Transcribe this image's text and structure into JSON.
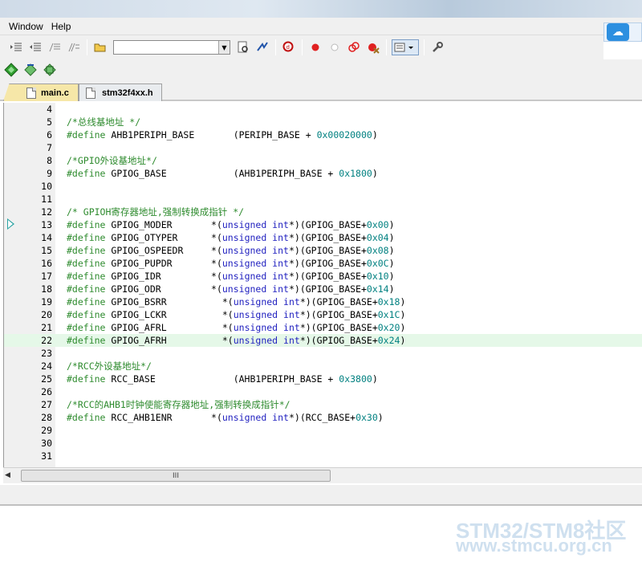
{
  "menu": {
    "items": [
      "Window",
      "Help"
    ]
  },
  "toolbar": {
    "combo_value": "",
    "icons": [
      "indent-icon",
      "outdent-icon",
      "comment-icon",
      "uncomment-icon",
      "open-folder-icon",
      "find-in-files-icon",
      "goto-icon",
      "debug-session-icon",
      "breakpoint-icon",
      "disabled-breakpoint-icon",
      "kill-breakpoints-icon",
      "kill-all-icon",
      "window-layout-icon",
      "configure-icon"
    ]
  },
  "tabs": [
    {
      "label": "main.c",
      "active": false
    },
    {
      "label": "stm32f4xx.h",
      "active": true
    }
  ],
  "code": {
    "highlighted_line": "22",
    "lines": [
      {
        "n": "4",
        "parts": []
      },
      {
        "n": "5",
        "parts": [
          {
            "t": "/*总线基地址 */",
            "c": "cmt"
          }
        ]
      },
      {
        "n": "6",
        "parts": [
          {
            "t": "#define",
            "c": "pp"
          },
          {
            "t": " AHB1PERIPH_BASE       (PERIPH_BASE + ",
            "c": ""
          },
          {
            "t": "0x00020000",
            "c": "num"
          },
          {
            "t": ")",
            "c": ""
          }
        ]
      },
      {
        "n": "7",
        "parts": []
      },
      {
        "n": "8",
        "parts": [
          {
            "t": "/*GPIO外设基地址*/",
            "c": "cmt"
          }
        ]
      },
      {
        "n": "9",
        "parts": [
          {
            "t": "#define",
            "c": "pp"
          },
          {
            "t": " GPIOG_BASE            (AHB1PERIPH_BASE + ",
            "c": ""
          },
          {
            "t": "0x1800",
            "c": "num"
          },
          {
            "t": ")",
            "c": ""
          }
        ]
      },
      {
        "n": "10",
        "parts": []
      },
      {
        "n": "11",
        "parts": []
      },
      {
        "n": "12",
        "parts": [
          {
            "t": "/* GPIOH寄存器地址,强制转换成指针 */",
            "c": "cmt"
          }
        ]
      },
      {
        "n": "13",
        "parts": [
          {
            "t": "#define",
            "c": "pp"
          },
          {
            "t": " GPIOG_MODER       *(",
            "c": ""
          },
          {
            "t": "unsigned int",
            "c": "kw"
          },
          {
            "t": "*)(GPIOG_BASE+",
            "c": ""
          },
          {
            "t": "0x00",
            "c": "num"
          },
          {
            "t": ")",
            "c": ""
          }
        ]
      },
      {
        "n": "14",
        "parts": [
          {
            "t": "#define",
            "c": "pp"
          },
          {
            "t": " GPIOG_OTYPER      *(",
            "c": ""
          },
          {
            "t": "unsigned int",
            "c": "kw"
          },
          {
            "t": "*)(GPIOG_BASE+",
            "c": ""
          },
          {
            "t": "0x04",
            "c": "num"
          },
          {
            "t": ")",
            "c": ""
          }
        ]
      },
      {
        "n": "15",
        "parts": [
          {
            "t": "#define",
            "c": "pp"
          },
          {
            "t": " GPIOG_OSPEEDR     *(",
            "c": ""
          },
          {
            "t": "unsigned int",
            "c": "kw"
          },
          {
            "t": "*)(GPIOG_BASE+",
            "c": ""
          },
          {
            "t": "0x08",
            "c": "num"
          },
          {
            "t": ")",
            "c": ""
          }
        ]
      },
      {
        "n": "16",
        "parts": [
          {
            "t": "#define",
            "c": "pp"
          },
          {
            "t": " GPIOG_PUPDR       *(",
            "c": ""
          },
          {
            "t": "unsigned int",
            "c": "kw"
          },
          {
            "t": "*)(GPIOG_BASE+",
            "c": ""
          },
          {
            "t": "0x0C",
            "c": "num"
          },
          {
            "t": ")",
            "c": ""
          }
        ]
      },
      {
        "n": "17",
        "parts": [
          {
            "t": "#define",
            "c": "pp"
          },
          {
            "t": " GPIOG_IDR         *(",
            "c": ""
          },
          {
            "t": "unsigned int",
            "c": "kw"
          },
          {
            "t": "*)(GPIOG_BASE+",
            "c": ""
          },
          {
            "t": "0x10",
            "c": "num"
          },
          {
            "t": ")",
            "c": ""
          }
        ]
      },
      {
        "n": "18",
        "parts": [
          {
            "t": "#define",
            "c": "pp"
          },
          {
            "t": " GPIOG_ODR         *(",
            "c": ""
          },
          {
            "t": "unsigned int",
            "c": "kw"
          },
          {
            "t": "*)(GPIOG_BASE+",
            "c": ""
          },
          {
            "t": "0x14",
            "c": "num"
          },
          {
            "t": ")",
            "c": ""
          }
        ]
      },
      {
        "n": "19",
        "parts": [
          {
            "t": "#define",
            "c": "pp"
          },
          {
            "t": " GPIOG_BSRR          *(",
            "c": ""
          },
          {
            "t": "unsigned int",
            "c": "kw"
          },
          {
            "t": "*)(GPIOG_BASE+",
            "c": ""
          },
          {
            "t": "0x18",
            "c": "num"
          },
          {
            "t": ")",
            "c": ""
          }
        ]
      },
      {
        "n": "20",
        "parts": [
          {
            "t": "#define",
            "c": "pp"
          },
          {
            "t": " GPIOG_LCKR          *(",
            "c": ""
          },
          {
            "t": "unsigned int",
            "c": "kw"
          },
          {
            "t": "*)(GPIOG_BASE+",
            "c": ""
          },
          {
            "t": "0x1C",
            "c": "num"
          },
          {
            "t": ")",
            "c": ""
          }
        ]
      },
      {
        "n": "21",
        "parts": [
          {
            "t": "#define",
            "c": "pp"
          },
          {
            "t": " GPIOG_AFRL          *(",
            "c": ""
          },
          {
            "t": "unsigned int",
            "c": "kw"
          },
          {
            "t": "*)(GPIOG_BASE+",
            "c": ""
          },
          {
            "t": "0x20",
            "c": "num"
          },
          {
            "t": ")",
            "c": ""
          }
        ]
      },
      {
        "n": "22",
        "parts": [
          {
            "t": "#define",
            "c": "pp"
          },
          {
            "t": " GPIOG_AFRH          *(",
            "c": ""
          },
          {
            "t": "unsigned int",
            "c": "kw"
          },
          {
            "t": "*)(GPIOG_BASE+",
            "c": ""
          },
          {
            "t": "0x24",
            "c": "num"
          },
          {
            "t": ")",
            "c": ""
          }
        ]
      },
      {
        "n": "23",
        "parts": []
      },
      {
        "n": "24",
        "parts": [
          {
            "t": "/*RCC外设基地址*/",
            "c": "cmt"
          }
        ]
      },
      {
        "n": "25",
        "parts": [
          {
            "t": "#define",
            "c": "pp"
          },
          {
            "t": " RCC_BASE              (AHB1PERIPH_BASE + ",
            "c": ""
          },
          {
            "t": "0x3800",
            "c": "num"
          },
          {
            "t": ")",
            "c": ""
          }
        ]
      },
      {
        "n": "26",
        "parts": []
      },
      {
        "n": "27",
        "parts": [
          {
            "t": "/*RCC的AHB1时钟使能寄存器地址,强制转换成指针*/",
            "c": "cmt"
          }
        ]
      },
      {
        "n": "28",
        "parts": [
          {
            "t": "#define",
            "c": "pp"
          },
          {
            "t": " RCC_AHB1ENR       *(",
            "c": ""
          },
          {
            "t": "unsigned int",
            "c": "kw"
          },
          {
            "t": "*)(RCC_BASE+",
            "c": ""
          },
          {
            "t": "0x30",
            "c": "num"
          },
          {
            "t": ")",
            "c": ""
          }
        ]
      },
      {
        "n": "29",
        "parts": []
      },
      {
        "n": "30",
        "parts": []
      },
      {
        "n": "31",
        "parts": []
      }
    ]
  },
  "scrollbar": {
    "thumb_grip": "III"
  },
  "watermark": {
    "line1": "STM32/STM8社区",
    "line2": "www.stmcu.org.cn"
  },
  "colors": {
    "comment": "#2e8b2e",
    "keyword": "#1f1fbf",
    "number": "#008080",
    "current_line": "#e5f8e8"
  }
}
